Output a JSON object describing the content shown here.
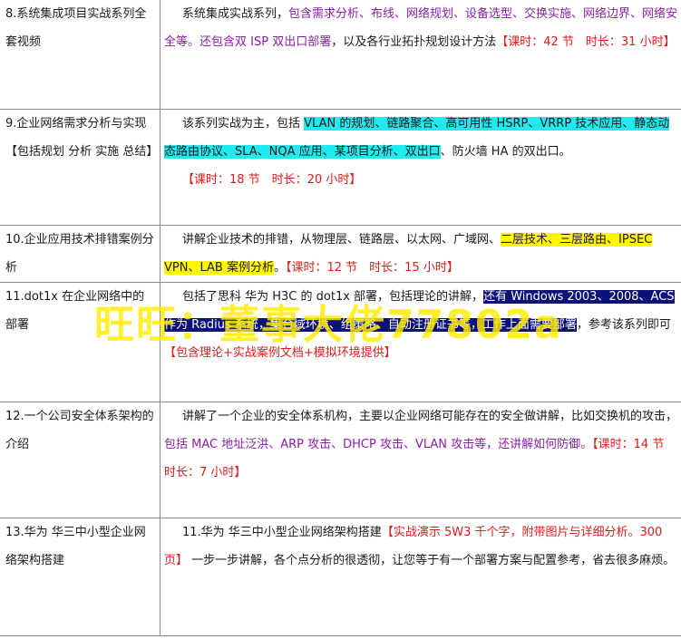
{
  "rows": [
    {
      "title": "8.系统集成项目实战系列全套视频",
      "segments": [
        {
          "text": "系统集成实战系列，",
          "style": "plain"
        },
        {
          "text": "包含需求分析、布线、网络规划、设备选型、交换实施、网络边界、网络安全等。还包含双 ISP 双出口部署",
          "style": "purple"
        },
        {
          "text": "，以及各行业拓扑规划设计方法",
          "style": "plain"
        },
        {
          "text": "【课时：42 节　时长：31 小时】",
          "style": "red"
        }
      ]
    },
    {
      "title": "9.企业网络需求分析与实现【包括规划 分析 实施 总结】",
      "segments": [
        {
          "text": "该系列实战为主，包括 ",
          "style": "plain"
        },
        {
          "text": "VLAN 的规划、链路聚合、高可用性 HSRP、VRRP 技术应用、静态动态路由协议、SLA、NQA 应用、某项目分析、双出口",
          "style": "cyan"
        },
        {
          "text": "、防火墙 HA 的双出口。",
          "style": "plain"
        },
        {
          "text": "【课时：18 节　时长：20 小时】",
          "style": "red-block"
        }
      ]
    },
    {
      "title": "10.企业应用技术排错案例分析",
      "segments": [
        {
          "text": "讲解企业技术的排错，从物理层、链路层、以太网、广域网、",
          "style": "plain"
        },
        {
          "text": "二层技术、三层路由、IPSEC VPN、LAB 案例分析",
          "style": "yellow"
        },
        {
          "text": "。",
          "style": "plain"
        },
        {
          "text": "【课时：12 节　时长：15 小时】",
          "style": "red"
        }
      ]
    },
    {
      "title": "11.dot1x 在企业网络中的部署",
      "segments": [
        {
          "text": "包括了思科 华为 H3C 的 dot1x 部署，包括理论的讲解，",
          "style": "plain"
        },
        {
          "text": "还有 Windows 2003、2008、ACS 作为 Radius 系统，集合域环境、组策略、自动注册证书等，工作上面需要部署",
          "style": "navy"
        },
        {
          "text": "，参考该系列即可",
          "style": "plain"
        },
        {
          "text": "【包含理论+实战案例文档+模拟环境提供】",
          "style": "red"
        }
      ]
    },
    {
      "title": "12.一个公司安全体系架构的介绍",
      "segments": [
        {
          "text": "讲解了一个企业的安全体系机构，主要以企业网络可能存在的安全做讲解，比如交换机的攻击，",
          "style": "plain"
        },
        {
          "text": "包括 MAC 地址泛洪、ARP 攻击、DHCP 攻击、VLAN 攻击等，还讲解如何防御。",
          "style": "purple"
        },
        {
          "text": "【课时：14 节　时长：7 小时】",
          "style": "red"
        }
      ]
    },
    {
      "title": "13.华为 华三中小型企业网络架构搭建",
      "segments": [
        {
          "text": "11.华为 华三中小型企业网络架构搭建",
          "style": "plain"
        },
        {
          "text": "【实战演示 5W3 千个字，附带图片与详细分析。300 页】",
          "style": "red"
        },
        {
          "text": " 一步一步讲解，各个点分析的很透彻，让您等于有一个部署方案与配置参考，省去很多麻烦。",
          "style": "plain"
        }
      ]
    }
  ],
  "watermark": "旺旺：董事大佬77802a"
}
